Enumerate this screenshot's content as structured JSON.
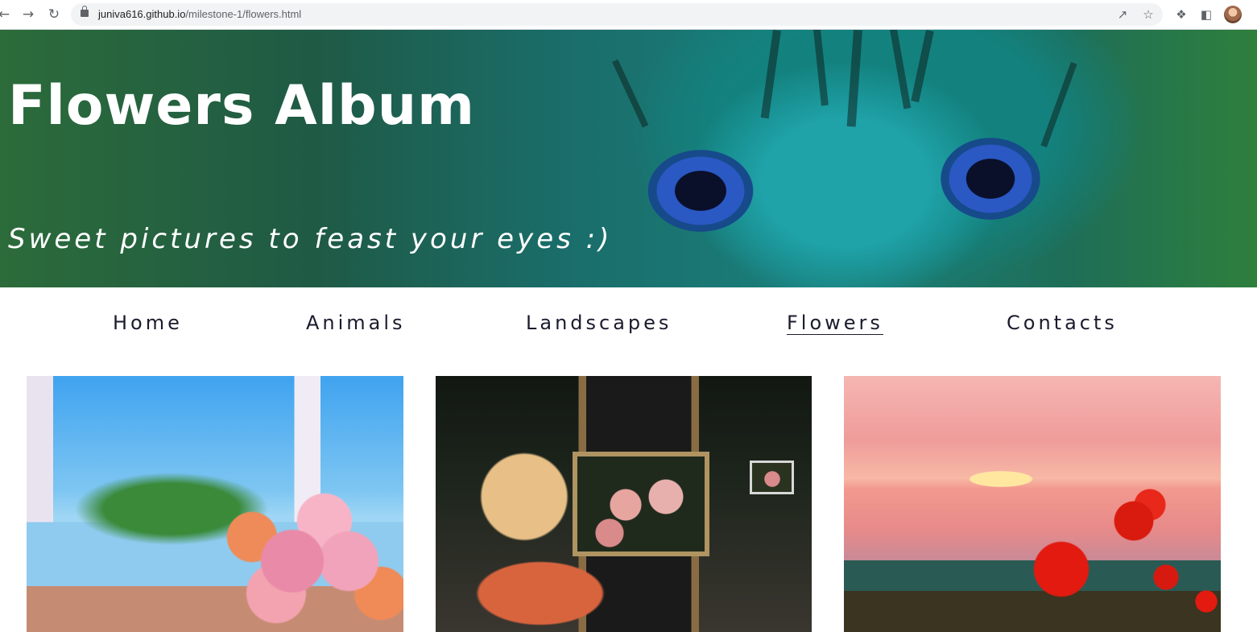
{
  "browser": {
    "url_host": "juniva616.github.io",
    "url_path": "/milestone-1/flowers.html",
    "back_icon": "arrow-left-icon",
    "forward_icon": "arrow-right-icon",
    "reload_icon": "reload-icon",
    "lock_icon": "lock-icon",
    "share_icon": "share-icon",
    "bookmark_icon": "star-icon",
    "extensions_icon": "puzzle-icon",
    "sidepanel_icon": "side-panel-icon",
    "profile_icon": "avatar"
  },
  "hero": {
    "title": "Flowers Album",
    "subtitle": "Sweet pictures to feast your eyes :)"
  },
  "nav": {
    "items": [
      {
        "label": "Home",
        "active": false
      },
      {
        "label": "Animals",
        "active": false
      },
      {
        "label": "Landscapes",
        "active": false
      },
      {
        "label": "Flowers",
        "active": true
      },
      {
        "label": "Contacts",
        "active": false
      }
    ]
  },
  "gallery": {
    "images": [
      {
        "subject": "pink-and-orange-roses-by-window-painting"
      },
      {
        "subject": "artist-with-flower-painting-on-easel-photo"
      },
      {
        "subject": "red-poppies-at-sunset-sea-painting"
      }
    ]
  },
  "colors": {
    "nav_text": "#1b1b2e",
    "hero_text": "#ffffff"
  }
}
